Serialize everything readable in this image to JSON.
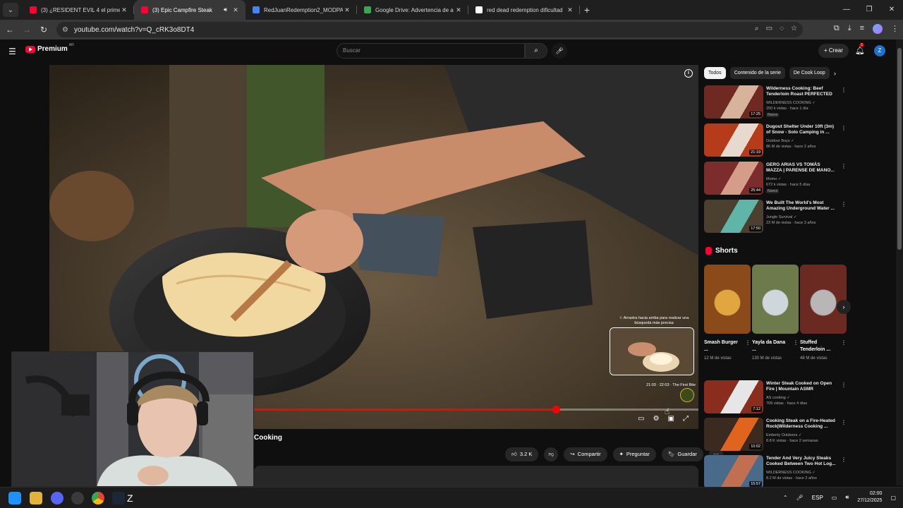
{
  "browser": {
    "tabs": [
      {
        "title": "(3) ¿RESIDENT EVIL 4 el primer",
        "color": "#ff0033",
        "active": false
      },
      {
        "title": "(3) Epic Campfire Steak",
        "color": "#ff0033",
        "active": true
      },
      {
        "title": "RedJuanRedemption2_MODPA",
        "color": "#4285f4",
        "active": false
      },
      {
        "title": "Google Drive: Advertencia de a",
        "color": "#34a853",
        "active": false
      },
      {
        "title": "red dead redemption dificultad",
        "color": "#ffffff",
        "active": false
      }
    ],
    "url": "youtube.com/watch?v=Q_cRK3o8DT4"
  },
  "header": {
    "logo_text": "Premium",
    "region": "AR",
    "search_placeholder": "Buscar",
    "create_label": "Crear",
    "notif_count": "3",
    "avatar_letter": "Z"
  },
  "player": {
    "drag_tip": "☆ Arrastra hacia arriba para realizar una búsqueda más precisa",
    "preview_label": "21:03 · 22:03 · The First Bite",
    "progress_fraction": 0.78
  },
  "video": {
    "title_partial": "Cooking",
    "likes": "3.2 K",
    "share_label": "Compartir",
    "ask_label": "Preguntar",
    "save_label": "Guardar"
  },
  "chips": [
    "Todos",
    "Contenido de la serie",
    "De Cook Loop"
  ],
  "recommendations_top": [
    {
      "title": "Wilderness Cooking: Beef Tenderloin Roast PERFECTED",
      "channel": "WILDERNESS COOKING",
      "meta": "250 k vistas · hace 1 día",
      "duration": "17:25",
      "nuevo": "Nuevo",
      "colors": [
        "#6e2a22",
        "#d7b39c"
      ]
    },
    {
      "title": "Dugout Shelter Under 10ft (3m) of Snow - Solo Camping in ...",
      "channel": "Outdoor Boys",
      "meta": "86 M de vistas · hace 2 años",
      "duration": "21:19",
      "nuevo": "",
      "colors": [
        "#b53b1a",
        "#e8d9cf"
      ]
    },
    {
      "title": "GERO ARIAS VS TOMÁS MAZZA | PARENSE DE MANO...",
      "channel": "Momo",
      "meta": "672 k vistas · hace 5 días",
      "duration": "25:44",
      "nuevo": "Nuevo",
      "colors": [
        "#7c2c2c",
        "#d59c8a"
      ]
    },
    {
      "title": "We Built The World's Most Amazing Underground Water ...",
      "channel": "Jungle Survival",
      "meta": "23 M de vistas · hace 3 años",
      "duration": "17:50",
      "nuevo": "",
      "colors": [
        "#4b4030",
        "#5fb5a8"
      ]
    }
  ],
  "shorts": {
    "heading": "Shorts",
    "items": [
      {
        "title": "Smash Burger ...",
        "views": "12 M de vistas",
        "colors": [
          "#8a4a1a",
          "#e2a640"
        ]
      },
      {
        "title": "Yayla da Dana ...",
        "views": "130 M de vistas",
        "colors": [
          "#6c7a4c",
          "#cfd6dc"
        ]
      },
      {
        "title": "Stuffed Tenderloin ...",
        "views": "48 M de vistas",
        "colors": [
          "#6a2a22",
          "#b7b7b7"
        ]
      }
    ]
  },
  "recommendations_bottom": [
    {
      "title": "Winter Steak Cooked on Open Fire | Mountain ASMR",
      "channel": "AS cooking",
      "meta": "709 vistas · hace 4 días",
      "duration": "7:12",
      "nuevo": "",
      "colors": [
        "#8a2d1f",
        "#e6e6e6"
      ]
    },
    {
      "title": "Cooking Steak on a Fire-Heated Rock|Wilderness Cooking ...",
      "channel": "Emberly Outdoors",
      "meta": "8.8 K vistas · hace 2 semanas",
      "duration": "10:02",
      "nuevo": "",
      "colors": [
        "#3a2a20",
        "#e0631e"
      ]
    },
    {
      "title": "Tender And Very Juicy Steaks Cooked Between Two Hot Log...",
      "channel": "WILDERNESS COOKING",
      "meta": "8.2 M de vistas · hace 2 años",
      "duration": "15:57",
      "nuevo": "",
      "colors": [
        "#4a6a8a",
        "#c07050"
      ]
    }
  ],
  "taskbar": {
    "lang": "ESP",
    "time": "02:00",
    "date": "27/12/2025"
  }
}
